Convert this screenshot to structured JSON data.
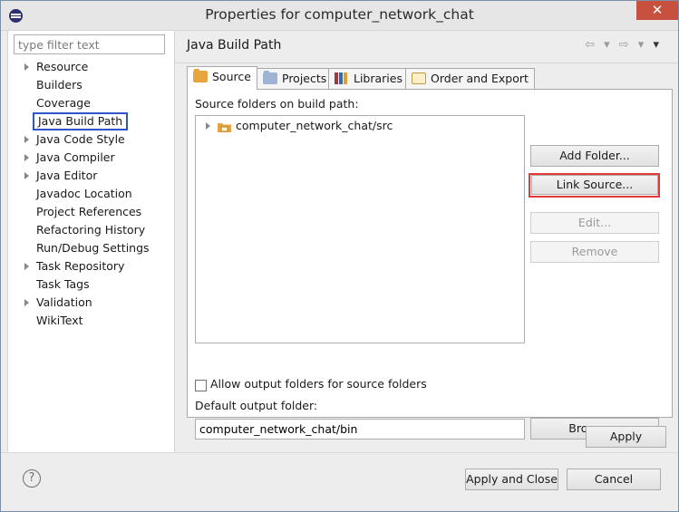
{
  "window": {
    "title": "Properties for computer_network_chat",
    "close_label": "✕"
  },
  "filter": {
    "placeholder": "type filter text"
  },
  "sidebar": {
    "items": [
      {
        "label": "Resource",
        "expandable": true
      },
      {
        "label": "Builders",
        "expandable": false
      },
      {
        "label": "Coverage",
        "expandable": false
      },
      {
        "label": "Java Build Path",
        "expandable": false,
        "selected": true
      },
      {
        "label": "Java Code Style",
        "expandable": true
      },
      {
        "label": "Java Compiler",
        "expandable": true
      },
      {
        "label": "Java Editor",
        "expandable": true
      },
      {
        "label": "Javadoc Location",
        "expandable": false
      },
      {
        "label": "Project References",
        "expandable": false
      },
      {
        "label": "Refactoring History",
        "expandable": false
      },
      {
        "label": "Run/Debug Settings",
        "expandable": false
      },
      {
        "label": "Task Repository",
        "expandable": true
      },
      {
        "label": "Task Tags",
        "expandable": false
      },
      {
        "label": "Validation",
        "expandable": true
      },
      {
        "label": "WikiText",
        "expandable": false
      }
    ]
  },
  "page": {
    "title": "Java Build Path",
    "nav": {
      "back": "⇦ ▾",
      "forward": "⇨ ▾",
      "menu": "▾"
    }
  },
  "tabs": [
    {
      "label": "Source",
      "icon": "source-folder-icon",
      "active": true
    },
    {
      "label": "Projects",
      "icon": "projects-folder-icon",
      "active": false
    },
    {
      "label": "Libraries",
      "icon": "libraries-icon",
      "active": false
    },
    {
      "label": "Order and Export",
      "icon": "order-export-icon",
      "active": false
    }
  ],
  "source": {
    "section_label": "Source folders on build path:",
    "folders": [
      {
        "label": "computer_network_chat/src"
      }
    ],
    "buttons": {
      "add_folder": "Add Folder...",
      "link_source": "Link Source...",
      "edit": "Edit...",
      "remove": "Remove",
      "browse": "Browse..."
    },
    "allow_output_label": "Allow output folders for source folders",
    "allow_output_checked": false,
    "default_output_label": "Default output folder:",
    "default_output_value": "computer_network_chat/bin"
  },
  "footer": {
    "apply": "Apply",
    "apply_and_close": "Apply and Close",
    "cancel": "Cancel",
    "help_icon": "?"
  },
  "colors": {
    "selection_outline": "#2d55c9",
    "highlight_outline": "#e53935",
    "close_button": "#c7503f"
  }
}
